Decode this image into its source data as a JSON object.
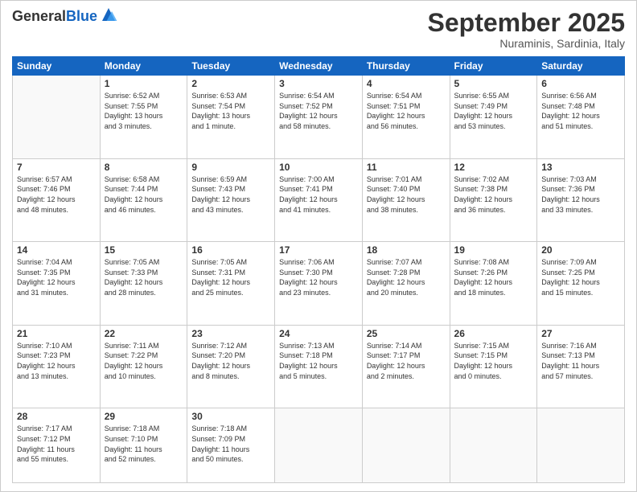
{
  "logo": {
    "general": "General",
    "blue": "Blue"
  },
  "header": {
    "month": "September 2025",
    "location": "Nuraminis, Sardinia, Italy"
  },
  "weekdays": [
    "Sunday",
    "Monday",
    "Tuesday",
    "Wednesday",
    "Thursday",
    "Friday",
    "Saturday"
  ],
  "weeks": [
    [
      {
        "day": "",
        "info": ""
      },
      {
        "day": "1",
        "info": "Sunrise: 6:52 AM\nSunset: 7:55 PM\nDaylight: 13 hours\nand 3 minutes."
      },
      {
        "day": "2",
        "info": "Sunrise: 6:53 AM\nSunset: 7:54 PM\nDaylight: 13 hours\nand 1 minute."
      },
      {
        "day": "3",
        "info": "Sunrise: 6:54 AM\nSunset: 7:52 PM\nDaylight: 12 hours\nand 58 minutes."
      },
      {
        "day": "4",
        "info": "Sunrise: 6:54 AM\nSunset: 7:51 PM\nDaylight: 12 hours\nand 56 minutes."
      },
      {
        "day": "5",
        "info": "Sunrise: 6:55 AM\nSunset: 7:49 PM\nDaylight: 12 hours\nand 53 minutes."
      },
      {
        "day": "6",
        "info": "Sunrise: 6:56 AM\nSunset: 7:48 PM\nDaylight: 12 hours\nand 51 minutes."
      }
    ],
    [
      {
        "day": "7",
        "info": "Sunrise: 6:57 AM\nSunset: 7:46 PM\nDaylight: 12 hours\nand 48 minutes."
      },
      {
        "day": "8",
        "info": "Sunrise: 6:58 AM\nSunset: 7:44 PM\nDaylight: 12 hours\nand 46 minutes."
      },
      {
        "day": "9",
        "info": "Sunrise: 6:59 AM\nSunset: 7:43 PM\nDaylight: 12 hours\nand 43 minutes."
      },
      {
        "day": "10",
        "info": "Sunrise: 7:00 AM\nSunset: 7:41 PM\nDaylight: 12 hours\nand 41 minutes."
      },
      {
        "day": "11",
        "info": "Sunrise: 7:01 AM\nSunset: 7:40 PM\nDaylight: 12 hours\nand 38 minutes."
      },
      {
        "day": "12",
        "info": "Sunrise: 7:02 AM\nSunset: 7:38 PM\nDaylight: 12 hours\nand 36 minutes."
      },
      {
        "day": "13",
        "info": "Sunrise: 7:03 AM\nSunset: 7:36 PM\nDaylight: 12 hours\nand 33 minutes."
      }
    ],
    [
      {
        "day": "14",
        "info": "Sunrise: 7:04 AM\nSunset: 7:35 PM\nDaylight: 12 hours\nand 31 minutes."
      },
      {
        "day": "15",
        "info": "Sunrise: 7:05 AM\nSunset: 7:33 PM\nDaylight: 12 hours\nand 28 minutes."
      },
      {
        "day": "16",
        "info": "Sunrise: 7:05 AM\nSunset: 7:31 PM\nDaylight: 12 hours\nand 25 minutes."
      },
      {
        "day": "17",
        "info": "Sunrise: 7:06 AM\nSunset: 7:30 PM\nDaylight: 12 hours\nand 23 minutes."
      },
      {
        "day": "18",
        "info": "Sunrise: 7:07 AM\nSunset: 7:28 PM\nDaylight: 12 hours\nand 20 minutes."
      },
      {
        "day": "19",
        "info": "Sunrise: 7:08 AM\nSunset: 7:26 PM\nDaylight: 12 hours\nand 18 minutes."
      },
      {
        "day": "20",
        "info": "Sunrise: 7:09 AM\nSunset: 7:25 PM\nDaylight: 12 hours\nand 15 minutes."
      }
    ],
    [
      {
        "day": "21",
        "info": "Sunrise: 7:10 AM\nSunset: 7:23 PM\nDaylight: 12 hours\nand 13 minutes."
      },
      {
        "day": "22",
        "info": "Sunrise: 7:11 AM\nSunset: 7:22 PM\nDaylight: 12 hours\nand 10 minutes."
      },
      {
        "day": "23",
        "info": "Sunrise: 7:12 AM\nSunset: 7:20 PM\nDaylight: 12 hours\nand 8 minutes."
      },
      {
        "day": "24",
        "info": "Sunrise: 7:13 AM\nSunset: 7:18 PM\nDaylight: 12 hours\nand 5 minutes."
      },
      {
        "day": "25",
        "info": "Sunrise: 7:14 AM\nSunset: 7:17 PM\nDaylight: 12 hours\nand 2 minutes."
      },
      {
        "day": "26",
        "info": "Sunrise: 7:15 AM\nSunset: 7:15 PM\nDaylight: 12 hours\nand 0 minutes."
      },
      {
        "day": "27",
        "info": "Sunrise: 7:16 AM\nSunset: 7:13 PM\nDaylight: 11 hours\nand 57 minutes."
      }
    ],
    [
      {
        "day": "28",
        "info": "Sunrise: 7:17 AM\nSunset: 7:12 PM\nDaylight: 11 hours\nand 55 minutes."
      },
      {
        "day": "29",
        "info": "Sunrise: 7:18 AM\nSunset: 7:10 PM\nDaylight: 11 hours\nand 52 minutes."
      },
      {
        "day": "30",
        "info": "Sunrise: 7:18 AM\nSunset: 7:09 PM\nDaylight: 11 hours\nand 50 minutes."
      },
      {
        "day": "",
        "info": ""
      },
      {
        "day": "",
        "info": ""
      },
      {
        "day": "",
        "info": ""
      },
      {
        "day": "",
        "info": ""
      }
    ]
  ]
}
